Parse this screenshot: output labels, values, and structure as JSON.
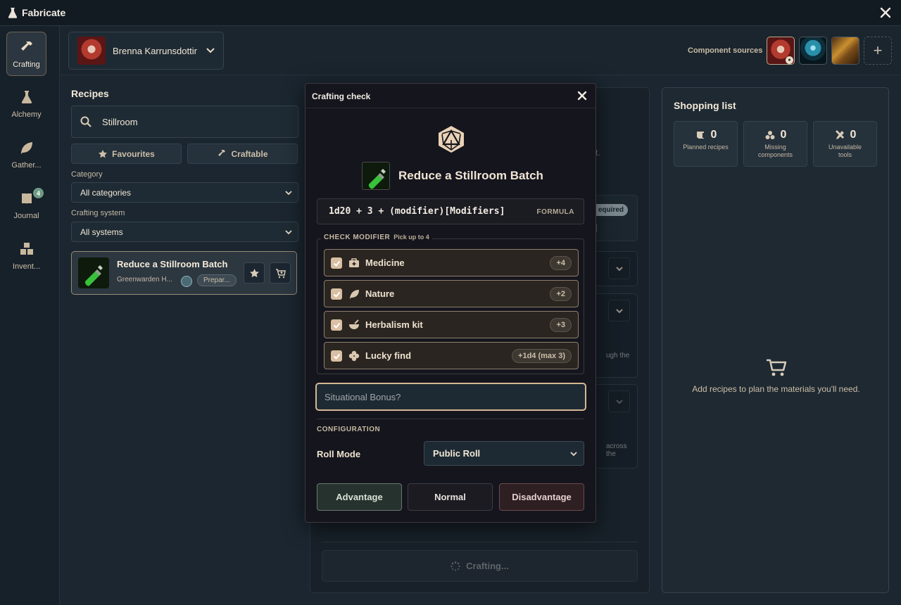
{
  "app": {
    "title": "Fabricate"
  },
  "nav": [
    {
      "label": "Crafting",
      "icon": "hammer-icon",
      "active": true
    },
    {
      "label": "Alchemy",
      "icon": "flask-icon"
    },
    {
      "label": "Gather...",
      "icon": "leaf-icon"
    },
    {
      "label": "Journal",
      "icon": "book-icon",
      "badge": "4"
    },
    {
      "label": "Invent...",
      "icon": "boxes-icon"
    }
  ],
  "header": {
    "character_name": "Brenna Karrunsdottir",
    "sources_label": "Component sources",
    "add_source": "+"
  },
  "recipes": {
    "title": "Recipes",
    "search_value": "Stillroom",
    "favourites_label": "Favourites",
    "craftable_label": "Craftable",
    "category_label": "Category",
    "category_value": "All categories",
    "system_label": "Crafting system",
    "system_value": "All systems",
    "item": {
      "name": "Reduce a Stillroom Batch",
      "source": "Greenwarden H...",
      "tag": "Prepar..."
    }
  },
  "middle": {
    "required_pill": "equired",
    "bracket_text": "]",
    "snippet_1": "t.",
    "snippet_2": "ugh the",
    "snippet_3": "across the",
    "crafting_button": "Crafting..."
  },
  "shopping": {
    "title": "Shopping list",
    "stats": [
      {
        "value": "0",
        "label": "Planned recipes",
        "icon": "scroll-icon"
      },
      {
        "value": "0",
        "label": "Missing components",
        "icon": "components-icon"
      },
      {
        "value": "0",
        "label": "Unavailable tools",
        "icon": "tools-icon"
      }
    ],
    "empty_text": "Add recipes to plan the materials you'll need."
  },
  "modal": {
    "title": "Crafting check",
    "recipe_name": "Reduce a Stillroom Batch",
    "formula": "1d20 + 3 + (modifier)[Modifiers]",
    "formula_tag": "FORMULA",
    "modifier_legend": "CHECK MODIFIER",
    "modifier_hint": "Pick up to 4",
    "modifiers": [
      {
        "name": "Medicine",
        "value": "+4",
        "icon": "medkit-icon",
        "checked": true
      },
      {
        "name": "Nature",
        "value": "+2",
        "icon": "leaf-icon",
        "checked": true
      },
      {
        "name": "Herbalism kit",
        "value": "+3",
        "icon": "mortar-icon",
        "checked": true
      },
      {
        "name": "Lucky find",
        "value": "+1d4 (max 3)",
        "icon": "clover-icon",
        "checked": true
      }
    ],
    "situational_placeholder": "Situational Bonus?",
    "config_label": "CONFIGURATION",
    "roll_mode_label": "Roll Mode",
    "roll_mode_value": "Public Roll",
    "buttons": {
      "advantage": "Advantage",
      "normal": "Normal",
      "disadvantage": "Disadvantage"
    }
  },
  "colors": {
    "accent": "#d6b794",
    "background": "#1b2630",
    "modal": "#15151d"
  }
}
